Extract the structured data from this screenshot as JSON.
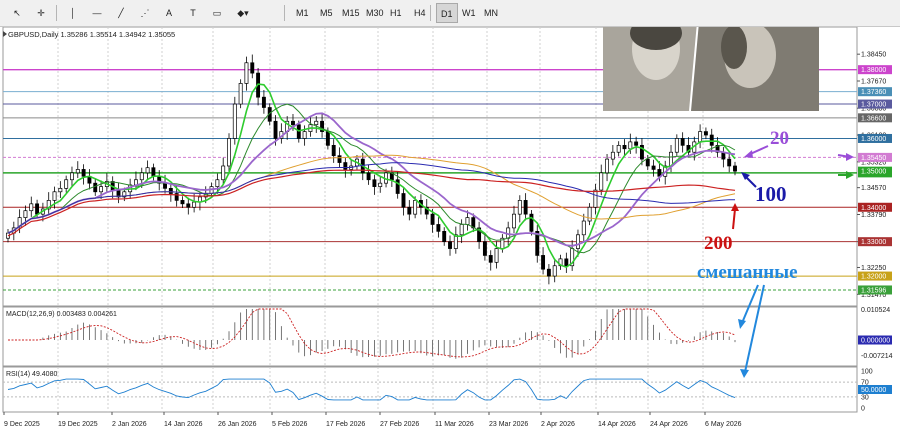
{
  "toolbar": {
    "tools": [
      {
        "name": "cursor-icon",
        "glyph": "↖"
      },
      {
        "name": "crosshair-icon",
        "glyph": "✛"
      },
      {
        "name": "vertical-line-icon",
        "glyph": "│"
      },
      {
        "name": "horizontal-line-icon",
        "glyph": "—"
      },
      {
        "name": "trendline-icon",
        "glyph": "╱"
      },
      {
        "name": "channel-icon",
        "glyph": "⋰"
      },
      {
        "name": "text-icon",
        "glyph": "A"
      },
      {
        "name": "text-label-icon",
        "glyph": "T"
      },
      {
        "name": "rectangle-icon",
        "glyph": "▭"
      },
      {
        "name": "shapes-icon",
        "glyph": "◆▾"
      }
    ],
    "timeframes": [
      "M1",
      "M5",
      "M15",
      "M30",
      "H1",
      "H4",
      "D1",
      "W1",
      "MN"
    ],
    "active_timeframe": "D1"
  },
  "chart": {
    "header": "GBPUSD,Daily  1.35286 1.35514 1.34942 1.35055",
    "macd_label": "MACD(12,26,9) 0.003483 0.004261",
    "rsi_label": "RSI(14) 49.4080",
    "annotations": {
      "ma20": "20",
      "ma100": "100",
      "ma200": "200",
      "mixed": "смешанные"
    },
    "price_axis": {
      "ticks": [
        "1.38450",
        "1.37670",
        "1.36880",
        "1.36100",
        "1.35320",
        "1.34570",
        "1.33790",
        "1.33000",
        "1.32250",
        "1.31470"
      ],
      "level_labels": [
        {
          "text": "1.38000",
          "color": "#cc44cc"
        },
        {
          "text": "1.37360",
          "color": "#4a8fb6"
        },
        {
          "text": "1.37000",
          "color": "#5a5a9e"
        },
        {
          "text": "1.36600",
          "color": "#666666"
        },
        {
          "text": "1.36000",
          "color": "#2f6f9f"
        },
        {
          "text": "1.35450",
          "color": "#d27bd2"
        },
        {
          "text": "1.35000",
          "color": "#2aa52a"
        },
        {
          "text": "1.34000",
          "color": "#aa2222"
        },
        {
          "text": "1.33000",
          "color": "#aa3333"
        },
        {
          "text": "1.32000",
          "color": "#c8a218"
        },
        {
          "text": "1.31596",
          "color": "#3aa03a"
        }
      ]
    },
    "macd_axis": {
      "ticks": [
        "0.010524",
        "-0.007214"
      ],
      "zero_label": "0.000000"
    },
    "rsi_axis": {
      "ticks": [
        "100",
        "70",
        "30",
        "0"
      ],
      "value_label": "50.0000"
    },
    "date_axis": [
      "9 Dec 2025",
      "19 Dec 2025",
      "2 Jan 2026",
      "14 Jan 2026",
      "26 Jan 2026",
      "5 Feb 2026",
      "17 Feb 2026",
      "27 Feb 2026",
      "11 Mar 2026",
      "23 Mar 2026",
      "2 Apr 2026",
      "14 Apr 2026",
      "24 Apr 2026",
      "6 May 2026"
    ],
    "colors": {
      "ma20": "#2ecc2e",
      "ma50": "#2d8a2d",
      "ma100": "#9a66cc",
      "ma100b": "#2a2ab0",
      "ma200": "#cc2222",
      "ma_orange": "#e0a030",
      "annotation_purple": "#9a4ed8",
      "annotation_blue": "#1a1aa8",
      "annotation_red": "#cc1111",
      "annotation_cyan": "#2288dd"
    }
  }
}
